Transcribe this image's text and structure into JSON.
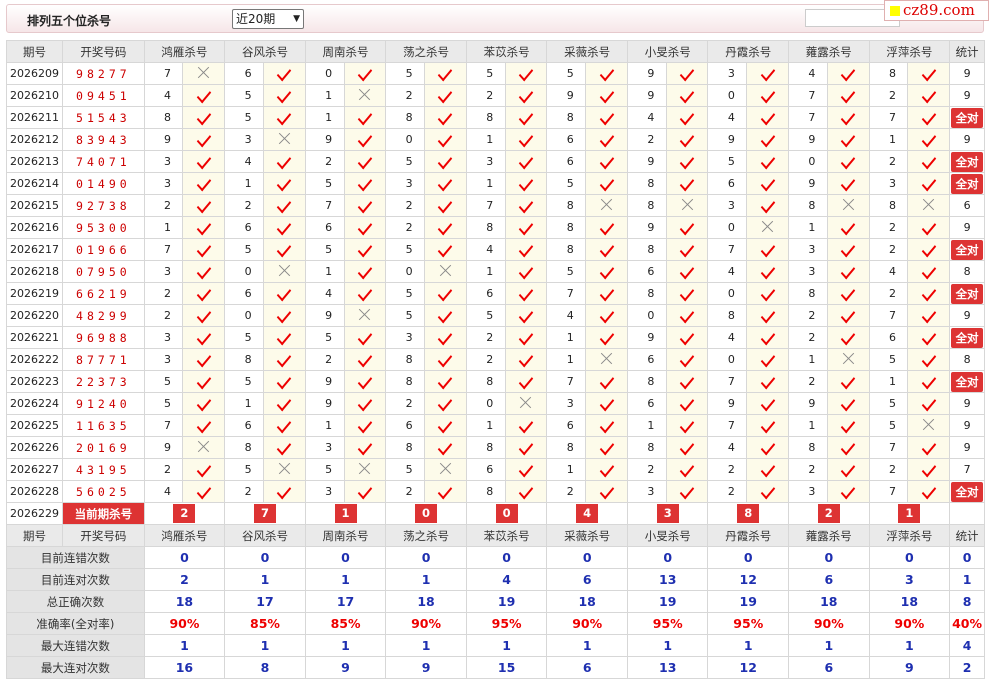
{
  "header": {
    "title": "排列五个位杀号",
    "period_select": "近20期",
    "logo": "cz89.com"
  },
  "columns": {
    "period": "期号",
    "draw": "开奖号码",
    "experts": [
      "鸿雁杀号",
      "谷风杀号",
      "周南杀号",
      "荡之杀号",
      "苯苡杀号",
      "采薇杀号",
      "小旻杀号",
      "丹霞杀号",
      "蕹露杀号",
      "浮萍杀号"
    ],
    "stat": "统计"
  },
  "rows": [
    {
      "p": "2026209",
      "n": "98277",
      "v": [
        "7",
        "6",
        "0",
        "5",
        "5",
        "5",
        "9",
        "3",
        "4",
        "8"
      ],
      "r": "xvvvvvvvvv",
      "s": "9"
    },
    {
      "p": "2026210",
      "n": "09451",
      "v": [
        "4",
        "5",
        "1",
        "2",
        "2",
        "9",
        "9",
        "0",
        "7",
        "2"
      ],
      "r": "vvxvvvvvvv",
      "s": "9"
    },
    {
      "p": "2026211",
      "n": "51543",
      "v": [
        "8",
        "5",
        "1",
        "8",
        "8",
        "8",
        "4",
        "4",
        "7",
        "7"
      ],
      "r": "vvvvvvvvvv",
      "s": "全对"
    },
    {
      "p": "2026212",
      "n": "83943",
      "v": [
        "9",
        "3",
        "9",
        "0",
        "1",
        "6",
        "2",
        "9",
        "9",
        "1"
      ],
      "r": "vxvvvvvvvv",
      "s": "9"
    },
    {
      "p": "2026213",
      "n": "74071",
      "v": [
        "3",
        "4",
        "2",
        "5",
        "3",
        "6",
        "9",
        "5",
        "0",
        "2"
      ],
      "r": "vvvvvvvvvv",
      "s": "全对"
    },
    {
      "p": "2026214",
      "n": "01490",
      "v": [
        "3",
        "1",
        "5",
        "3",
        "1",
        "5",
        "8",
        "6",
        "9",
        "3"
      ],
      "r": "vvvvvvvvvv",
      "s": "全对"
    },
    {
      "p": "2026215",
      "n": "92738",
      "v": [
        "2",
        "2",
        "7",
        "2",
        "7",
        "8",
        "8",
        "3",
        "8",
        "8"
      ],
      "r": "vvvvvxxvxx",
      "s": "6"
    },
    {
      "p": "2026216",
      "n": "95300",
      "v": [
        "1",
        "6",
        "6",
        "2",
        "8",
        "8",
        "9",
        "0",
        "1",
        "2"
      ],
      "r": "vvvvvvvxvv",
      "s": "9"
    },
    {
      "p": "2026217",
      "n": "01966",
      "v": [
        "7",
        "5",
        "5",
        "5",
        "4",
        "8",
        "8",
        "7",
        "3",
        "2"
      ],
      "r": "vvvvvvvvvv",
      "s": "全对"
    },
    {
      "p": "2026218",
      "n": "07950",
      "v": [
        "3",
        "0",
        "1",
        "0",
        "1",
        "5",
        "6",
        "4",
        "3",
        "4"
      ],
      "r": "vxvxvvvvvv",
      "s": "8"
    },
    {
      "p": "2026219",
      "n": "66219",
      "v": [
        "2",
        "6",
        "4",
        "5",
        "6",
        "7",
        "8",
        "0",
        "8",
        "2"
      ],
      "r": "vvvvvvvvvv",
      "s": "全对"
    },
    {
      "p": "2026220",
      "n": "48299",
      "v": [
        "2",
        "0",
        "9",
        "5",
        "5",
        "4",
        "0",
        "8",
        "2",
        "7"
      ],
      "r": "vvxvvvvvvv",
      "s": "9"
    },
    {
      "p": "2026221",
      "n": "96988",
      "v": [
        "3",
        "5",
        "5",
        "3",
        "2",
        "1",
        "9",
        "4",
        "2",
        "6"
      ],
      "r": "vvvvvvvvvv",
      "s": "全对"
    },
    {
      "p": "2026222",
      "n": "87771",
      "v": [
        "3",
        "8",
        "2",
        "8",
        "2",
        "1",
        "6",
        "0",
        "1",
        "5"
      ],
      "r": "vvvvvxvvxv",
      "s": "8"
    },
    {
      "p": "2026223",
      "n": "22373",
      "v": [
        "5",
        "5",
        "9",
        "8",
        "8",
        "7",
        "8",
        "7",
        "2",
        "1"
      ],
      "r": "vvvvvvvvvv",
      "s": "全对"
    },
    {
      "p": "2026224",
      "n": "91240",
      "v": [
        "5",
        "1",
        "9",
        "2",
        "0",
        "3",
        "6",
        "9",
        "9",
        "5"
      ],
      "r": "vvvvxvvvvv",
      "s": "9"
    },
    {
      "p": "2026225",
      "n": "11635",
      "v": [
        "7",
        "6",
        "1",
        "6",
        "1",
        "6",
        "1",
        "7",
        "1",
        "5"
      ],
      "r": "vvvvvvvvvx",
      "s": "9"
    },
    {
      "p": "2026226",
      "n": "20169",
      "v": [
        "9",
        "8",
        "3",
        "8",
        "8",
        "8",
        "8",
        "4",
        "8",
        "7"
      ],
      "r": "xvvvvvvvvv",
      "s": "9"
    },
    {
      "p": "2026227",
      "n": "43195",
      "v": [
        "2",
        "5",
        "5",
        "5",
        "6",
        "1",
        "2",
        "2",
        "2",
        "2"
      ],
      "r": "vxxxvvvvvv",
      "s": "7"
    },
    {
      "p": "2026228",
      "n": "56025",
      "v": [
        "4",
        "2",
        "3",
        "2",
        "8",
        "2",
        "3",
        "2",
        "3",
        "7"
      ],
      "r": "vvvvvvvvvv",
      "s": "全对"
    }
  ],
  "current": {
    "period": "2026229",
    "label": "当前期杀号",
    "values": [
      "2",
      "7",
      "1",
      "0",
      "0",
      "4",
      "3",
      "8",
      "2",
      "1"
    ]
  },
  "summary": [
    {
      "label": "目前连错次数",
      "values": [
        "0",
        "0",
        "0",
        "0",
        "0",
        "0",
        "0",
        "0",
        "0",
        "0"
      ],
      "stat": "0",
      "red": false
    },
    {
      "label": "目前连对次数",
      "values": [
        "2",
        "1",
        "1",
        "1",
        "4",
        "6",
        "13",
        "12",
        "6",
        "3"
      ],
      "stat": "1",
      "red": false
    },
    {
      "label": "总正确次数",
      "values": [
        "18",
        "17",
        "17",
        "18",
        "19",
        "18",
        "19",
        "19",
        "18",
        "18"
      ],
      "stat": "8",
      "red": false
    },
    {
      "label": "准确率(全对率)",
      "values": [
        "90%",
        "85%",
        "85%",
        "90%",
        "95%",
        "90%",
        "95%",
        "95%",
        "90%",
        "90%"
      ],
      "stat": "40%",
      "red": true
    },
    {
      "label": "最大连错次数",
      "values": [
        "1",
        "1",
        "1",
        "1",
        "1",
        "1",
        "1",
        "1",
        "1",
        "1"
      ],
      "stat": "4",
      "red": false
    },
    {
      "label": "最大连对次数",
      "values": [
        "16",
        "8",
        "9",
        "9",
        "15",
        "6",
        "13",
        "12",
        "6",
        "9"
      ],
      "stat": "2",
      "red": false
    }
  ]
}
